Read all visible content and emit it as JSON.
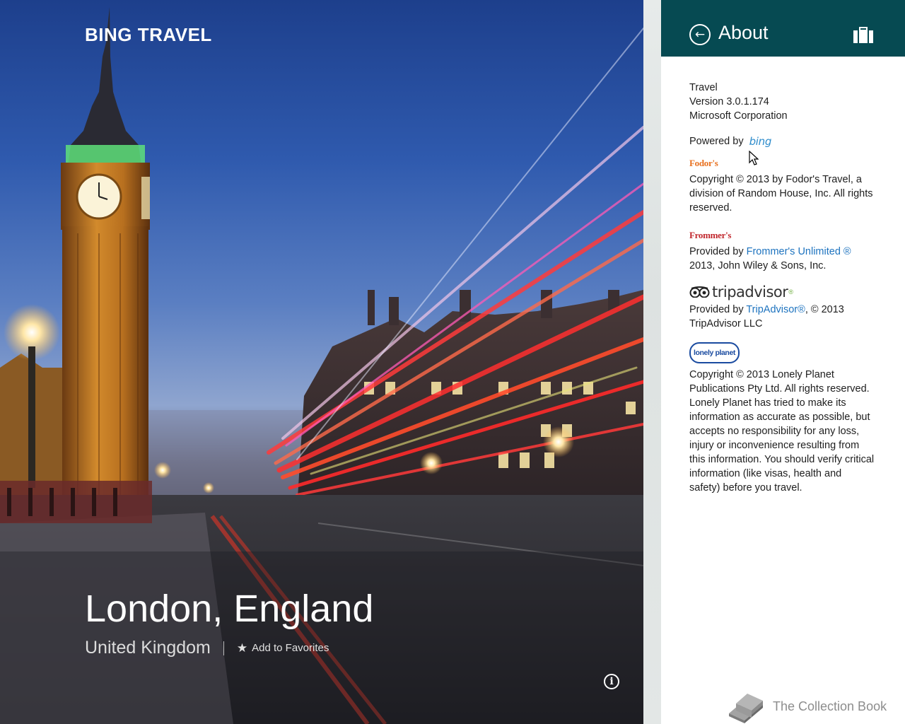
{
  "hero": {
    "app_title": "BING TRAVEL",
    "city": "London, England",
    "country": "United Kingdom",
    "favorites_label": "Add to Favorites",
    "info_label": "i"
  },
  "panel": {
    "title": "About",
    "accent_color": "#064a52",
    "app_info": {
      "name": "Travel",
      "version": "Version 3.0.1.174",
      "company": "Microsoft Corporation"
    },
    "powered_by_label": "Powered by",
    "powered_by_logo": "bing",
    "fodors": {
      "logo": "Fodor's",
      "text": "Copyright © 2013 by Fodor's Travel, a division of Random House, Inc. All rights reserved."
    },
    "frommers": {
      "logo": "Frommer's",
      "prefix": "Provided by ",
      "link": "Frommer's Unlimited ®",
      "suffix": "2013, John Wiley & Sons, Inc."
    },
    "tripadvisor": {
      "logo": "tripadvisor",
      "logo_mark": "®",
      "prefix": "Provided by ",
      "link": "TripAdvisor®",
      "suffix": ", © 2013 TripAdvisor LLC"
    },
    "lonely_planet": {
      "logo": "lonely planet",
      "copyright": "Copyright © 2013 Lonely Planet Publications Pty Ltd. All rights reserved.",
      "disclaimer": "Lonely Planet has tried to make its information as accurate as possible, but accepts no responsibility for any loss, injury or inconvenience resulting from this information. You should verify critical information (like visas, health and safety) before you travel."
    }
  },
  "watermark": {
    "text": "The Collection Book"
  },
  "icons": [
    "back-arrow-icon",
    "suitcase-icon",
    "star-icon",
    "info-icon",
    "book-icon",
    "cursor-icon"
  ]
}
